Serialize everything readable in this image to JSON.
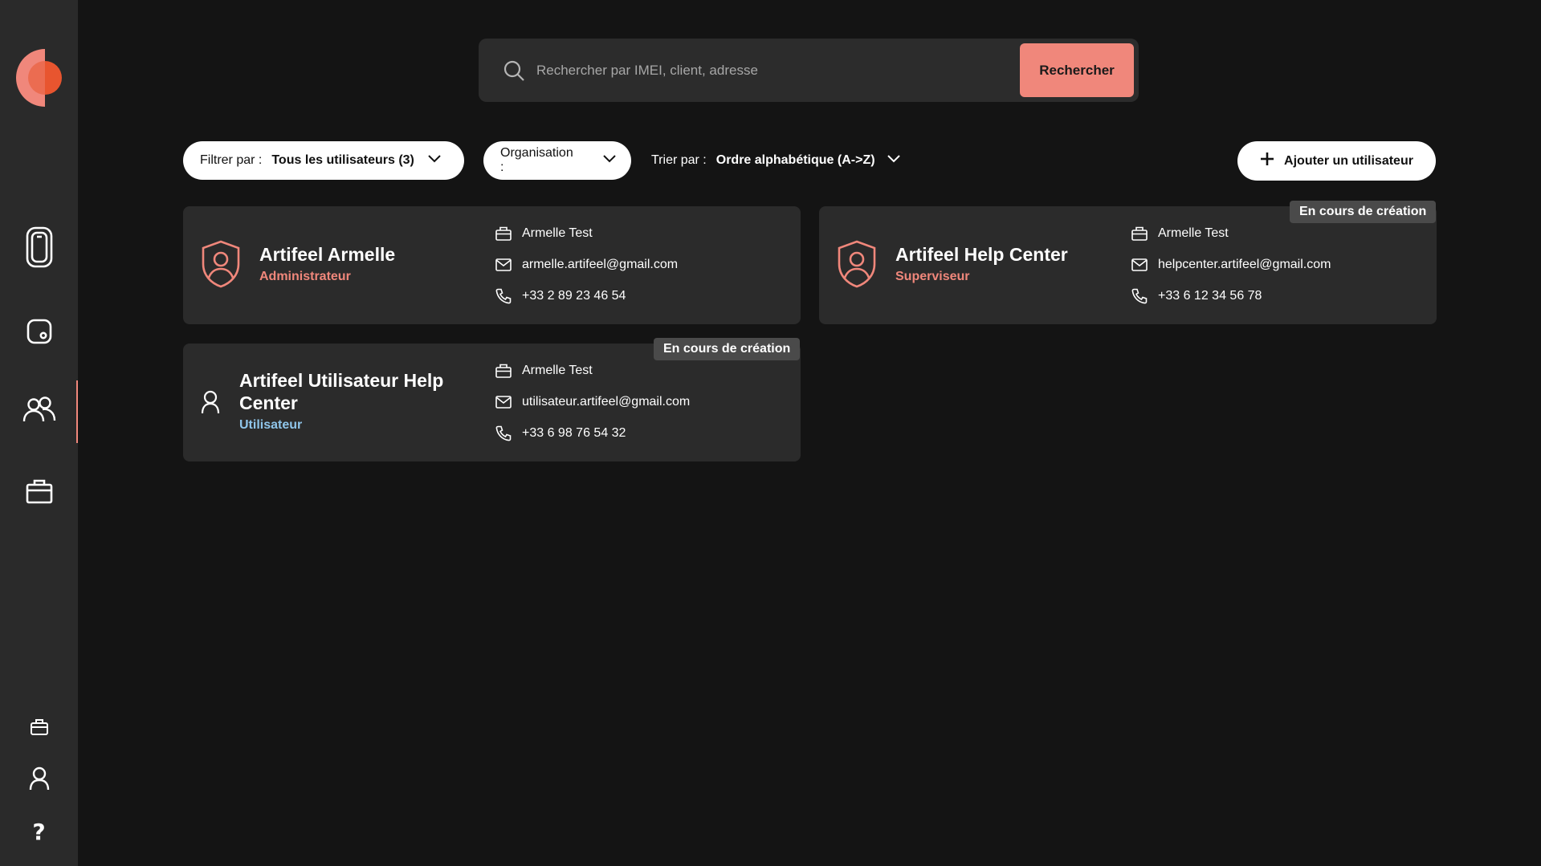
{
  "search": {
    "placeholder": "Rechercher par IMEI, client, adresse",
    "button_label": "Rechercher"
  },
  "filters": {
    "filter_label": "Filtrer par :",
    "filter_value": "Tous les utilisateurs (3)",
    "organisation_label": "Organisation :",
    "sort_label": "Trier par :",
    "sort_value": "Ordre alphabétique (A->Z)",
    "add_user_label": "Ajouter un utilisateur"
  },
  "users": [
    {
      "name": "Artifeel Armelle",
      "role": "Administrateur",
      "role_color": "#f0877b",
      "organisation": "Armelle Test",
      "email": "armelle.artifeel@gmail.com",
      "phone": "+33 2 89 23 46 54",
      "badge": ""
    },
    {
      "name": "Artifeel Help Center",
      "role": "Superviseur",
      "role_color": "#f0877b",
      "organisation": "Armelle Test",
      "email": "helpcenter.artifeel@gmail.com",
      "phone": "+33 6 12 34 56 78",
      "badge": "En cours de création"
    },
    {
      "name": "Artifeel Utilisateur Help Center",
      "role": "Utilisateur",
      "role_color": "#8fc5ea",
      "organisation": "Armelle Test",
      "email": "utilisateur.artifeel@gmail.com",
      "phone": "+33 6 98 76 54 32",
      "badge": "En cours de création"
    }
  ],
  "colors": {
    "accent": "#f0877b",
    "sidebar": "#2a2a2a",
    "background": "#141414",
    "card": "#2b2b2b"
  },
  "sidebar": {
    "items": [
      {
        "icon": "phone-device-icon"
      },
      {
        "icon": "tablet-icon"
      },
      {
        "icon": "users-icon",
        "active": true
      },
      {
        "icon": "briefcase-icon"
      }
    ],
    "bottom": [
      {
        "icon": "briefcase-small-icon"
      },
      {
        "icon": "user-icon"
      },
      {
        "icon": "help-icon"
      }
    ]
  }
}
